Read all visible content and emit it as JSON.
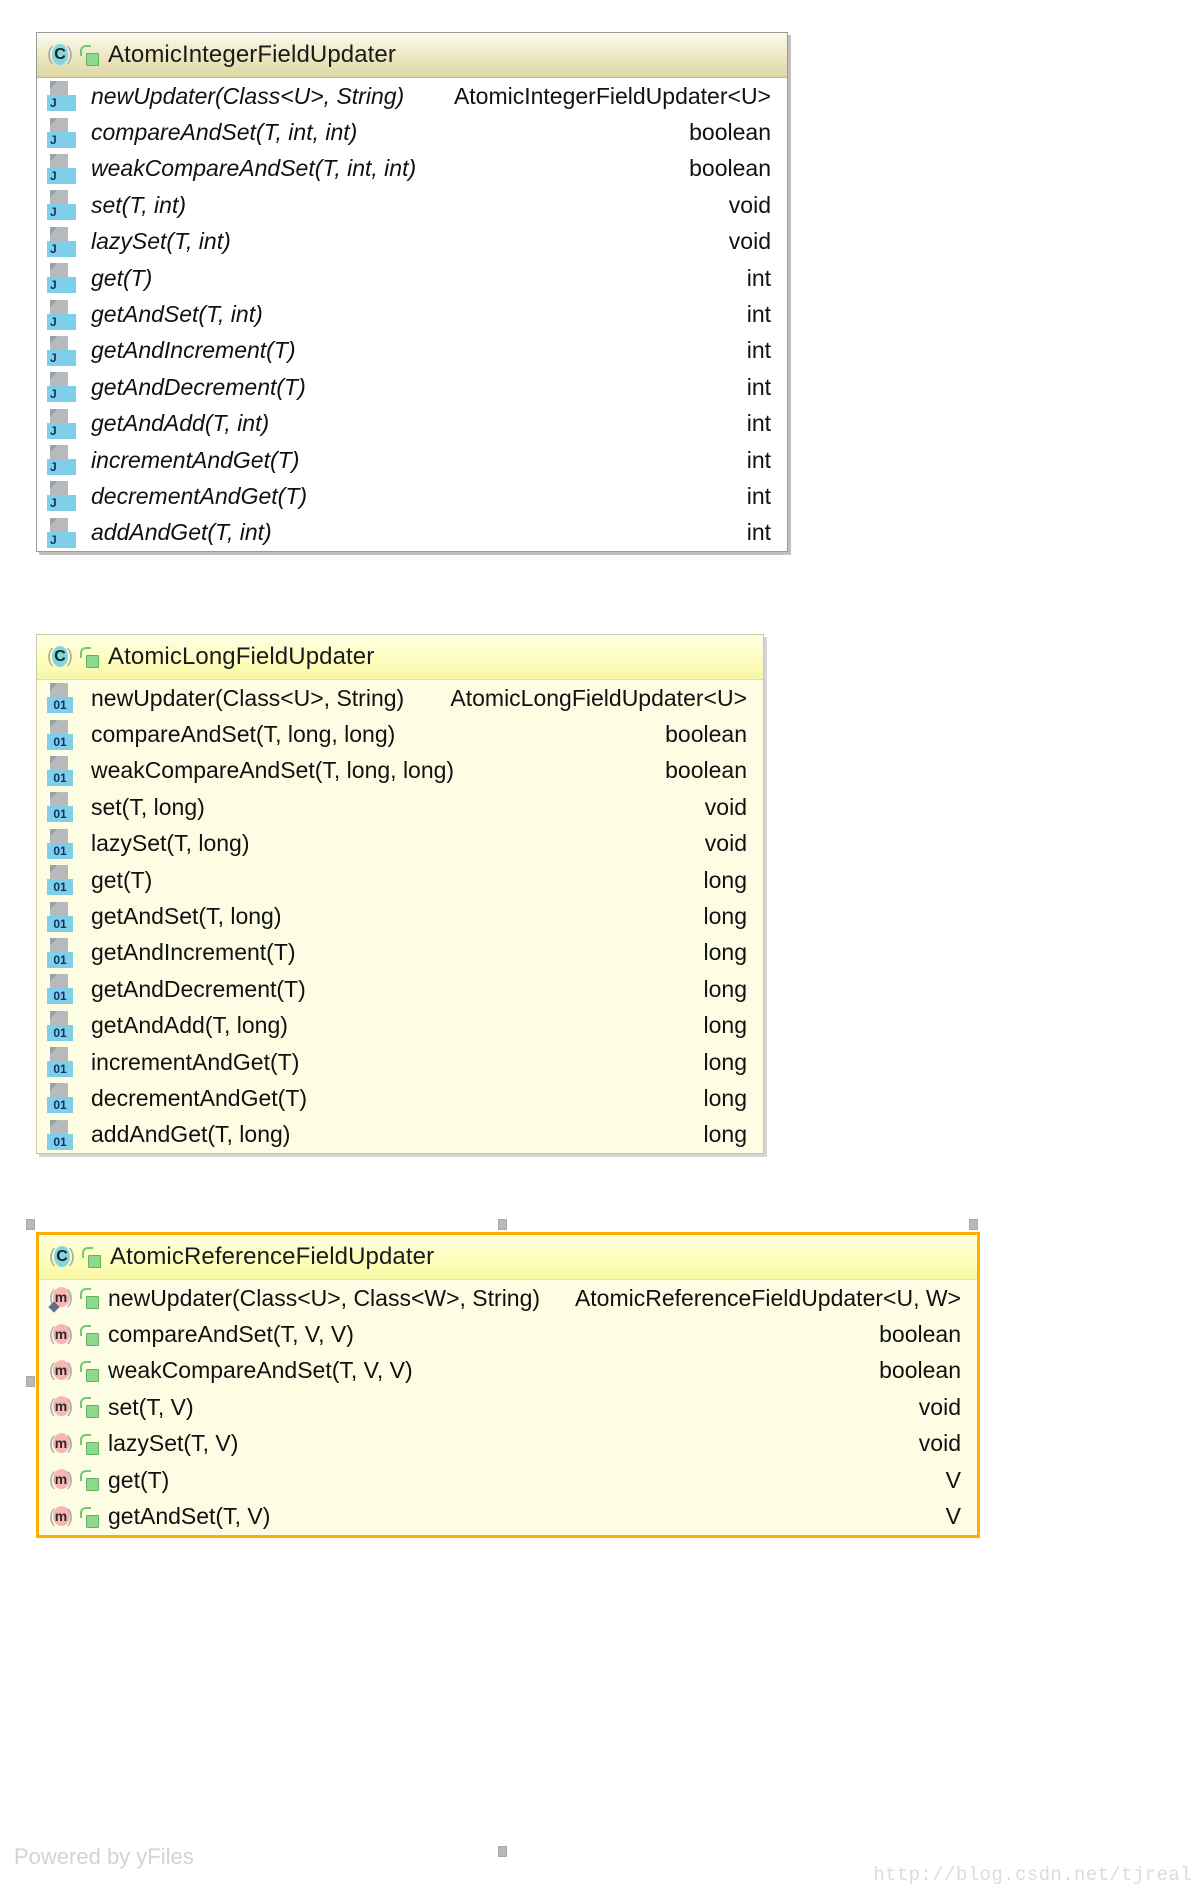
{
  "diagram": {
    "tool_watermark": "Powered by yFiles",
    "url_watermark": "http://blog.csdn.net/tjreal",
    "colors": {
      "selection_border": "#ffae00",
      "class_icon": "#7fd6e0",
      "method_icon": "#f7b5b5",
      "lock_icon": "#8fd98f",
      "badge": "#7fcfe8",
      "box1_body": "#ffffff",
      "box2_body": "#fdfde4",
      "box3_body": "#fdfde4"
    }
  },
  "classes": [
    {
      "name": "AtomicIntegerFieldUpdater",
      "class_icon": "class-icon",
      "visibility_icon": "unlocked-padlock-icon",
      "member_icon": "java-document-icon",
      "member_badge": "J",
      "italic": true,
      "selected": false,
      "members": [
        {
          "signature": "newUpdater(Class<U>, String)",
          "return": "AtomicIntegerFieldUpdater<U>"
        },
        {
          "signature": "compareAndSet(T, int, int)",
          "return": "boolean"
        },
        {
          "signature": "weakCompareAndSet(T, int, int)",
          "return": "boolean"
        },
        {
          "signature": "set(T, int)",
          "return": "void"
        },
        {
          "signature": "lazySet(T, int)",
          "return": "void"
        },
        {
          "signature": "get(T)",
          "return": "int"
        },
        {
          "signature": "getAndSet(T, int)",
          "return": "int"
        },
        {
          "signature": "getAndIncrement(T)",
          "return": "int"
        },
        {
          "signature": "getAndDecrement(T)",
          "return": "int"
        },
        {
          "signature": "getAndAdd(T, int)",
          "return": "int"
        },
        {
          "signature": "incrementAndGet(T)",
          "return": "int"
        },
        {
          "signature": "decrementAndGet(T)",
          "return": "int"
        },
        {
          "signature": "addAndGet(T, int)",
          "return": "int"
        }
      ]
    },
    {
      "name": "AtomicLongFieldUpdater",
      "class_icon": "class-icon",
      "visibility_icon": "unlocked-padlock-icon",
      "member_icon": "java-document-icon",
      "member_badge": "01",
      "italic": false,
      "selected": false,
      "members": [
        {
          "signature": "newUpdater(Class<U>, String)",
          "return": "AtomicLongFieldUpdater<U>"
        },
        {
          "signature": "compareAndSet(T, long, long)",
          "return": "boolean"
        },
        {
          "signature": "weakCompareAndSet(T, long, long)",
          "return": "boolean"
        },
        {
          "signature": "set(T, long)",
          "return": "void"
        },
        {
          "signature": "lazySet(T, long)",
          "return": "void"
        },
        {
          "signature": "get(T)",
          "return": "long"
        },
        {
          "signature": "getAndSet(T, long)",
          "return": "long"
        },
        {
          "signature": "getAndIncrement(T)",
          "return": "long"
        },
        {
          "signature": "getAndDecrement(T)",
          "return": "long"
        },
        {
          "signature": "getAndAdd(T, long)",
          "return": "long"
        },
        {
          "signature": "incrementAndGet(T)",
          "return": "long"
        },
        {
          "signature": "decrementAndGet(T)",
          "return": "long"
        },
        {
          "signature": "addAndGet(T, long)",
          "return": "long"
        }
      ]
    },
    {
      "name": "AtomicReferenceFieldUpdater",
      "class_icon": "class-icon",
      "visibility_icon": "unlocked-padlock-icon",
      "member_icon": "method-icon",
      "member_badge": "m",
      "italic": false,
      "selected": true,
      "members": [
        {
          "signature": "newUpdater(Class<U>, Class<W>, String)",
          "return": "AtomicReferenceFieldUpdater<U, W>"
        },
        {
          "signature": "compareAndSet(T, V, V)",
          "return": "boolean"
        },
        {
          "signature": "weakCompareAndSet(T, V, V)",
          "return": "boolean"
        },
        {
          "signature": "set(T, V)",
          "return": "void"
        },
        {
          "signature": "lazySet(T, V)",
          "return": "void"
        },
        {
          "signature": "get(T)",
          "return": "V"
        },
        {
          "signature": "getAndSet(T, V)",
          "return": "V"
        }
      ]
    }
  ]
}
